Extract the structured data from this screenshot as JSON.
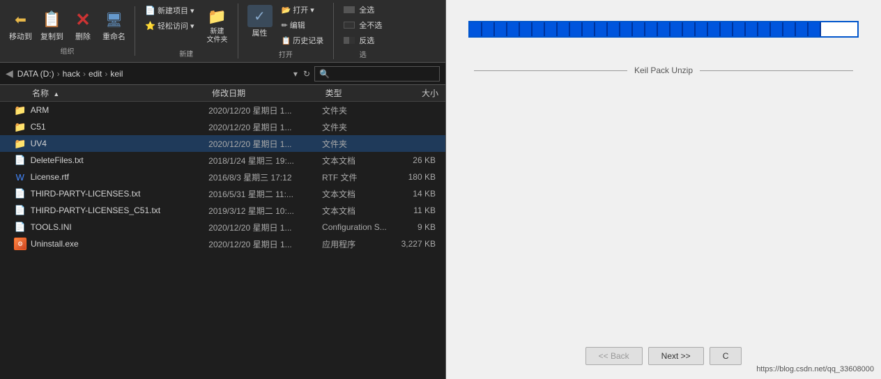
{
  "explorer": {
    "toolbar": {
      "groups": [
        {
          "label": "组织",
          "buttons_large": [
            {
              "id": "move",
              "icon": "←📁",
              "label": "移动到",
              "icon_type": "folder-arrow"
            },
            {
              "id": "copy",
              "icon": "📁",
              "label": "复制到",
              "icon_type": "folder-copy"
            },
            {
              "id": "delete",
              "icon": "✕",
              "label": "删除",
              "icon_type": "delete"
            },
            {
              "id": "rename",
              "icon": "🖥",
              "label": "重命名",
              "icon_type": "rename"
            }
          ]
        },
        {
          "label": "新建",
          "buttons_large": [
            {
              "id": "new-folder",
              "icon": "📁",
              "label": "新建\n文件夹",
              "icon_type": "folder"
            }
          ],
          "buttons_small": [
            {
              "id": "new-item",
              "label": "新建项目 ▾"
            },
            {
              "id": "easy-access",
              "label": "轻松访问 ▾"
            }
          ]
        },
        {
          "label": "打开",
          "buttons_large": [
            {
              "id": "props",
              "icon": "≡",
              "label": "属性",
              "icon_type": "props"
            }
          ],
          "buttons_small": [
            {
              "id": "open",
              "label": "📂 打开 ▾"
            },
            {
              "id": "edit",
              "label": "✏ 编辑"
            },
            {
              "id": "history",
              "label": "📋 历史记录"
            }
          ]
        },
        {
          "label": "选",
          "buttons_small": [
            {
              "id": "select-all",
              "label": "全选"
            },
            {
              "id": "select-none",
              "label": "全不选"
            },
            {
              "id": "invert",
              "label": "反选"
            }
          ]
        }
      ]
    },
    "address": {
      "path": [
        "DATA (D:)",
        "hack",
        "edit",
        "keil"
      ]
    },
    "columns": {
      "name": "名称",
      "date": "修改日期",
      "type": "类型",
      "size": "大小"
    },
    "files": [
      {
        "name": "ARM",
        "date": "2020/12/20 星期日 1...",
        "type": "文件夹",
        "size": "",
        "icon": "folder",
        "selected": false
      },
      {
        "name": "C51",
        "date": "2020/12/20 星期日 1...",
        "type": "文件夹",
        "size": "",
        "icon": "folder",
        "selected": false
      },
      {
        "name": "UV4",
        "date": "2020/12/20 星期日 1...",
        "type": "文件夹",
        "size": "",
        "icon": "folder",
        "selected": true
      },
      {
        "name": "DeleteFiles.txt",
        "date": "2018/1/24 星期三 19:...",
        "type": "文本文档",
        "size": "26 KB",
        "icon": "txt",
        "selected": false
      },
      {
        "name": "License.rtf",
        "date": "2016/8/3 星期三 17:12",
        "type": "RTF 文件",
        "size": "180 KB",
        "icon": "rtf",
        "selected": false
      },
      {
        "name": "THIRD-PARTY-LICENSES.txt",
        "date": "2016/5/31 星期二 11:...",
        "type": "文本文档",
        "size": "14 KB",
        "icon": "txt",
        "selected": false
      },
      {
        "name": "THIRD-PARTY-LICENSES_C51.txt",
        "date": "2019/3/12 星期二 10:...",
        "type": "文本文档",
        "size": "11 KB",
        "icon": "txt",
        "selected": false
      },
      {
        "name": "TOOLS.INI",
        "date": "2020/12/20 星期日 1...",
        "type": "Configuration S...",
        "size": "9 KB",
        "icon": "ini",
        "selected": false
      },
      {
        "name": "Uninstall.exe",
        "date": "2020/12/20 星期日 1...",
        "type": "应用程序",
        "size": "3,227 KB",
        "icon": "exe",
        "selected": false
      }
    ]
  },
  "dialog": {
    "title": "Keil Pack Unzip",
    "progress_segments": 28,
    "buttons": {
      "back": "<< Back",
      "next": "Next >>",
      "cancel": "C"
    },
    "bottom_link": "https://blog.csdn.net/qq_33608000"
  }
}
